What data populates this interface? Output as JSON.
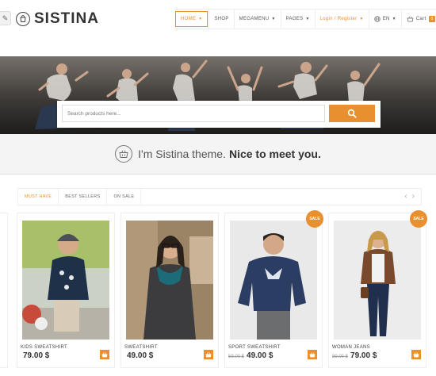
{
  "header": {
    "logo_text": "SISTINA",
    "nav": [
      {
        "label": "HOME",
        "has_caret": true
      },
      {
        "label": "SHOP",
        "has_caret": false
      },
      {
        "label": "MEGAMENU",
        "has_caret": true
      },
      {
        "label": "PAGES",
        "has_caret": true
      },
      {
        "label": "Login / Register",
        "has_caret": true
      },
      {
        "label": "EN",
        "has_caret": true
      },
      {
        "label": "Cart",
        "badge": "0"
      }
    ]
  },
  "search": {
    "placeholder": "Search products here..."
  },
  "tagline": {
    "lead": "I'm Sistina theme.",
    "strong": "Nice to meet you."
  },
  "tabs": [
    "MUST HAVE",
    "BEST SELLERS",
    "ON SALE"
  ],
  "products": [
    {
      "name": "KIDS SWEATSHIRT",
      "old_price": "",
      "price": "79.00 $",
      "sale": false
    },
    {
      "name": "SWEATSHIRT",
      "old_price": "",
      "price": "49.00 $",
      "sale": false
    },
    {
      "name": "SPORT SWEATSHIRT",
      "old_price": "59.00 $",
      "price": "49.00 $",
      "sale": true
    },
    {
      "name": "WOMAN JEANS",
      "old_price": "89.00 $",
      "price": "79.00 $",
      "sale": true
    }
  ],
  "sale_label": "SALE",
  "colors": {
    "accent": "#e8902f",
    "text": "#333333",
    "band": "#f4f4f4"
  },
  "icons": {
    "logo": "bag-icon",
    "search": "search-icon",
    "tagline": "basket-icon",
    "language": "globe-icon",
    "cart": "cart-icon",
    "add_to_cart": "basket-icon",
    "edit": "pencil-icon"
  }
}
